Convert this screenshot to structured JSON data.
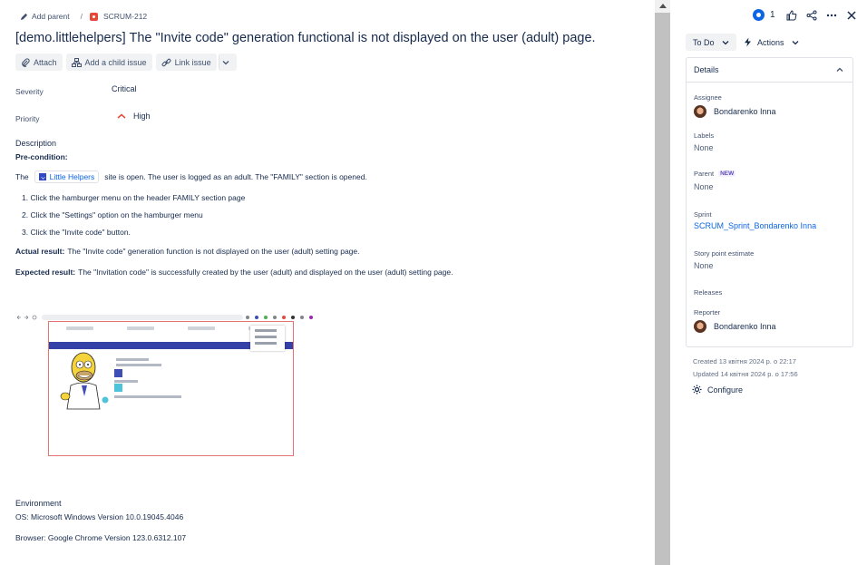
{
  "breadcrumb": {
    "add_parent": "Add parent",
    "separator": "/",
    "issue_key": "SCRUM-212"
  },
  "title": "[demo.littlehelpers] The \"Invite code\" generation functional is not displayed on the user (adult) page.",
  "toolbar": {
    "attach": "Attach",
    "add_child": "Add a child issue",
    "link_issue": "Link issue"
  },
  "fields": {
    "severity_label": "Severity",
    "severity_value": "Critical",
    "priority_label": "Priority",
    "priority_value": "High"
  },
  "description": {
    "label": "Description",
    "precondition": "Pre-condition:",
    "intro_before": "The",
    "link_text": "Little Helpers",
    "intro_after": "site is open. The user is logged as an adult. The \"FAMILY\" section is opened.",
    "steps": [
      "1. Click the hamburger menu on the header FAMILY section page",
      "2.  Click the \"Settings\" option on the  hamburger menu",
      "3. Click the \"Invite code\" button."
    ],
    "actual_label": "Actual result:",
    "actual_text": "The \"Invite code\" generation function is not displayed on the user (adult) setting page.",
    "expected_label": "Expected result:",
    "expected_text": "The \"Invitation code\" is successfully created by the user (adult) and displayed on the user (adult) setting page."
  },
  "environment": {
    "label": "Environment",
    "os": "OS: Microsoft Windows Version 10.0.19045.4046",
    "browser": "Browser: Google Chrome Version 123.0.6312.107"
  },
  "panel": {
    "watchers_count": "1",
    "status": "To Do",
    "actions": "Actions",
    "details_title": "Details",
    "assignee_label": "Assignee",
    "assignee": "Bondarenko Inna",
    "labels_label": "Labels",
    "labels": "None",
    "parent_label": "Parent",
    "parent_badge": "NEW",
    "parent": "None",
    "sprint_label": "Sprint",
    "sprint": "SCRUM_Sprint_Bondarenko Inna",
    "story_points_label": "Story point estimate",
    "story_points": "None",
    "releases_label": "Releases",
    "reporter_label": "Reporter",
    "reporter": "Bondarenko Inna",
    "created": "Created 13 квітня 2024 р. о 22:17",
    "updated": "Updated 14 квітня 2024 р. о 17:56",
    "configure": "Configure"
  },
  "colors": {
    "accent": "#0c66e4",
    "priority_high": "#e5493a",
    "bug": "#e5493a",
    "text": "#172b4d"
  }
}
